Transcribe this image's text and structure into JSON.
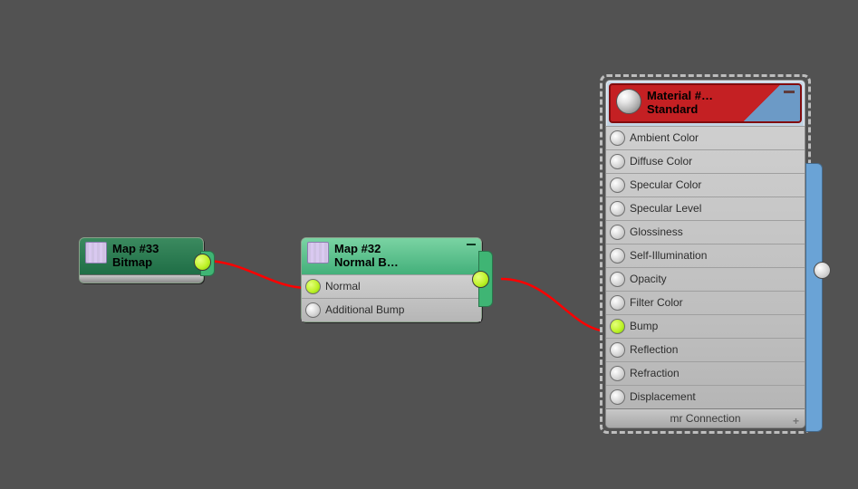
{
  "nodes": [
    {
      "title": "Map #33",
      "type": "Bitmap"
    },
    {
      "title": "Map #32",
      "type": "Normal  B…",
      "inputs": [
        "Normal",
        "Additional Bump"
      ]
    }
  ],
  "material": {
    "title": "Material #…",
    "type": "Standard",
    "footer": "mr Connection",
    "slots": [
      {
        "label": "Ambient Color",
        "connected": false
      },
      {
        "label": "Diffuse Color",
        "connected": false
      },
      {
        "label": "Specular Color",
        "connected": false
      },
      {
        "label": "Specular Level",
        "connected": false
      },
      {
        "label": "Glossiness",
        "connected": false
      },
      {
        "label": "Self-Illumination",
        "connected": false
      },
      {
        "label": "Opacity",
        "connected": false
      },
      {
        "label": "Filter Color",
        "connected": false
      },
      {
        "label": "Bump",
        "connected": true
      },
      {
        "label": "Reflection",
        "connected": false
      },
      {
        "label": "Refraction",
        "connected": false
      },
      {
        "label": "Displacement",
        "connected": false
      }
    ]
  },
  "connections": [
    {
      "from": "Map #33",
      "to": "Map #32",
      "to_slot": "Normal"
    },
    {
      "from": "Map #32",
      "to": "Material",
      "to_slot": "Bump"
    }
  ]
}
